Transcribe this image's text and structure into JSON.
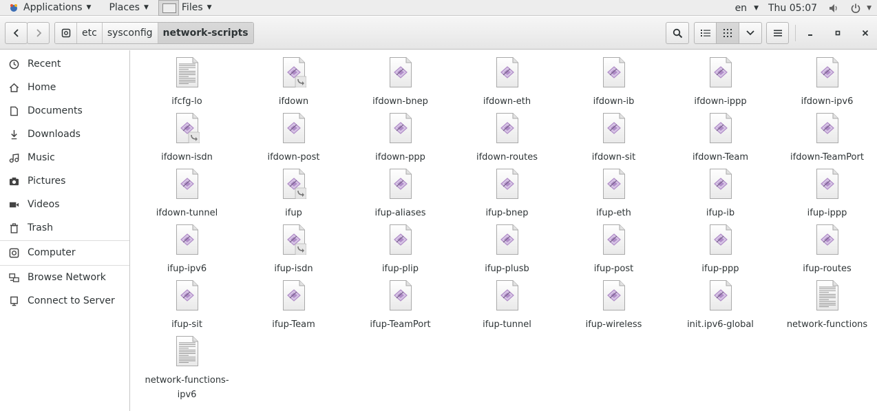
{
  "top_panel": {
    "applications": "Applications",
    "places": "Places",
    "files": "Files",
    "language": "en",
    "clock": "Thu 05:07"
  },
  "header": {
    "path": [
      "etc",
      "sysconfig",
      "network-scripts"
    ]
  },
  "sidebar": {
    "items": [
      {
        "label": "Recent",
        "icon": "clock-icon"
      },
      {
        "label": "Home",
        "icon": "home-icon"
      },
      {
        "label": "Documents",
        "icon": "document-icon"
      },
      {
        "label": "Downloads",
        "icon": "download-icon"
      },
      {
        "label": "Music",
        "icon": "music-icon"
      },
      {
        "label": "Pictures",
        "icon": "camera-icon"
      },
      {
        "label": "Videos",
        "icon": "video-icon"
      },
      {
        "label": "Trash",
        "icon": "trash-icon"
      },
      {
        "label": "Computer",
        "icon": "computer-icon"
      },
      {
        "label": "Browse Network",
        "icon": "network-icon"
      },
      {
        "label": "Connect to Server",
        "icon": "server-icon"
      }
    ]
  },
  "files": [
    {
      "name": "ifcfg-lo",
      "type": "text"
    },
    {
      "name": "ifdown",
      "type": "script-link"
    },
    {
      "name": "ifdown-bnep",
      "type": "script"
    },
    {
      "name": "ifdown-eth",
      "type": "script"
    },
    {
      "name": "ifdown-ib",
      "type": "script"
    },
    {
      "name": "ifdown-ippp",
      "type": "script"
    },
    {
      "name": "ifdown-ipv6",
      "type": "script"
    },
    {
      "name": "ifdown-isdn",
      "type": "script-link"
    },
    {
      "name": "ifdown-post",
      "type": "script"
    },
    {
      "name": "ifdown-ppp",
      "type": "script"
    },
    {
      "name": "ifdown-routes",
      "type": "script"
    },
    {
      "name": "ifdown-sit",
      "type": "script"
    },
    {
      "name": "ifdown-Team",
      "type": "script"
    },
    {
      "name": "ifdown-TeamPort",
      "type": "script"
    },
    {
      "name": "ifdown-tunnel",
      "type": "script"
    },
    {
      "name": "ifup",
      "type": "script-link"
    },
    {
      "name": "ifup-aliases",
      "type": "script"
    },
    {
      "name": "ifup-bnep",
      "type": "script"
    },
    {
      "name": "ifup-eth",
      "type": "script"
    },
    {
      "name": "ifup-ib",
      "type": "script"
    },
    {
      "name": "ifup-ippp",
      "type": "script"
    },
    {
      "name": "ifup-ipv6",
      "type": "script"
    },
    {
      "name": "ifup-isdn",
      "type": "script-link"
    },
    {
      "name": "ifup-plip",
      "type": "script"
    },
    {
      "name": "ifup-plusb",
      "type": "script"
    },
    {
      "name": "ifup-post",
      "type": "script"
    },
    {
      "name": "ifup-ppp",
      "type": "script"
    },
    {
      "name": "ifup-routes",
      "type": "script"
    },
    {
      "name": "ifup-sit",
      "type": "script"
    },
    {
      "name": "ifup-Team",
      "type": "script"
    },
    {
      "name": "ifup-TeamPort",
      "type": "script"
    },
    {
      "name": "ifup-tunnel",
      "type": "script"
    },
    {
      "name": "ifup-wireless",
      "type": "script"
    },
    {
      "name": "init.ipv6-global",
      "type": "script"
    },
    {
      "name": "network-functions",
      "type": "text"
    },
    {
      "name": "network-functions-ipv6",
      "type": "text"
    }
  ],
  "colors": {
    "script_diamond": "#b08cc8",
    "panel_bg": "#ededed"
  }
}
